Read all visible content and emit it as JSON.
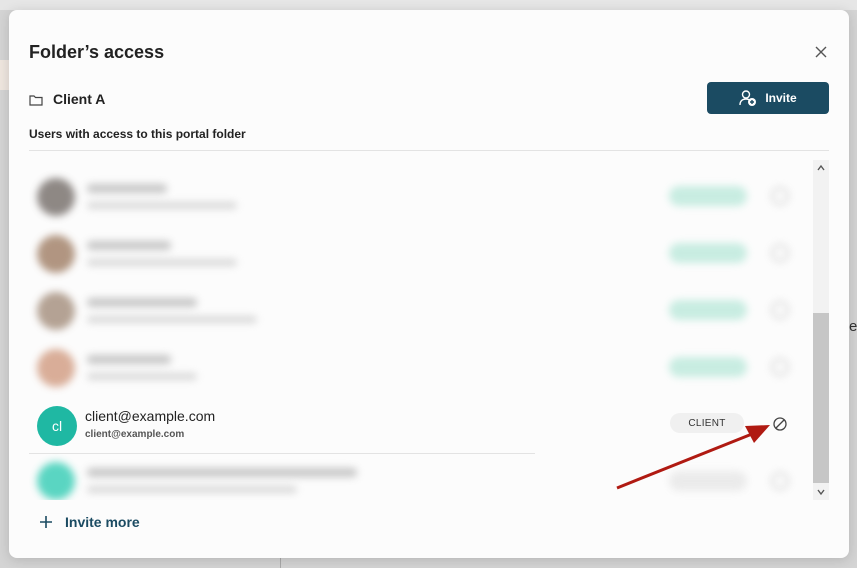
{
  "dialog": {
    "title": "Folder’s access",
    "folder_name": "Client A",
    "invite_label": "Invite",
    "section_label": "Users with access to this portal folder",
    "invite_more_label": "Invite more"
  },
  "users": [
    {
      "name": "client@example.com",
      "email": "client@example.com",
      "initials": "cl",
      "role": "CLIENT"
    }
  ],
  "icons": {
    "close": "close-icon",
    "folder": "folder-icon",
    "add_user": "add-user-icon",
    "revoke": "block-icon",
    "plus": "plus-icon"
  },
  "colors": {
    "primary": "#1b4b62",
    "avatar_client": "#1fb8a3",
    "annotation_arrow": "#b01a12"
  }
}
